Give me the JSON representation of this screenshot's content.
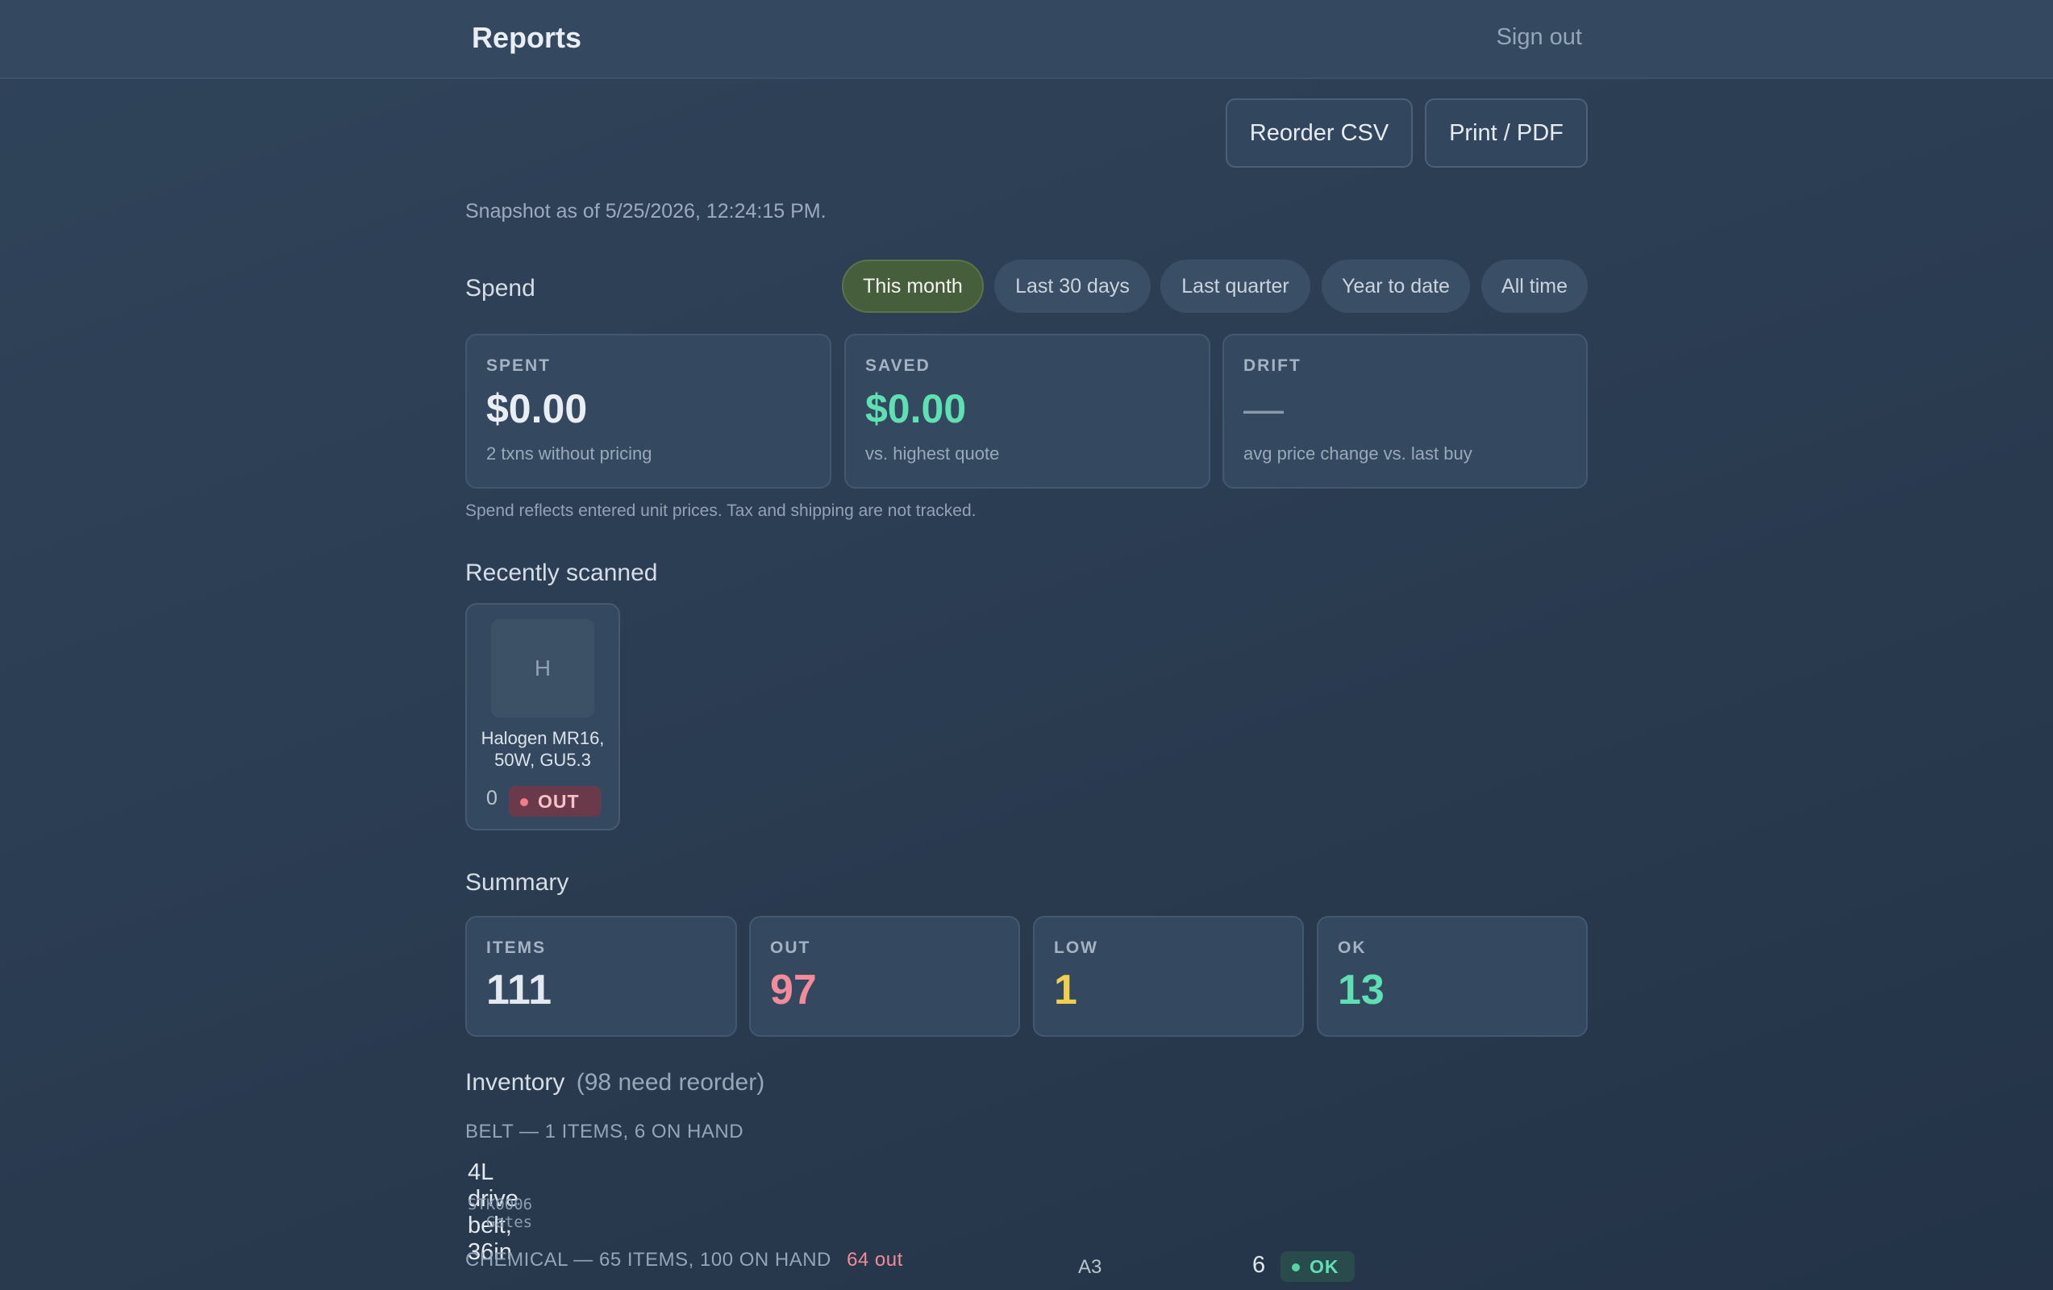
{
  "header": {
    "title": "Reports",
    "signout_label": "Sign out"
  },
  "actions": {
    "reorder_csv": "Reorder CSV",
    "print_pdf": "Print / PDF"
  },
  "snapshot": "Snapshot as of 5/25/2026, 12:24:15 PM.",
  "spend": {
    "title": "Spend",
    "ranges": [
      "This month",
      "Last 30 days",
      "Last quarter",
      "Year to date",
      "All time"
    ],
    "active_range": "This month",
    "cards": [
      {
        "label": "SPENT",
        "value": "$0.00",
        "sub": "2 txns without pricing"
      },
      {
        "label": "SAVED",
        "value": "$0.00",
        "sub": "vs. highest quote"
      },
      {
        "label": "DRIFT",
        "value": "—",
        "sub": "avg price change vs. last buy"
      }
    ],
    "footnote": "Spend reflects entered unit prices. Tax and shipping are not tracked."
  },
  "recent": {
    "title": "Recently scanned",
    "items": [
      {
        "initial": "H",
        "name_line1": "Halogen MR16,",
        "name_line2": "50W, GU5.3",
        "qty": "0",
        "status": "OUT"
      }
    ]
  },
  "summary": {
    "title": "Summary",
    "cards": [
      {
        "label": "ITEMS",
        "value": "111"
      },
      {
        "label": "OUT",
        "value": "97"
      },
      {
        "label": "LOW",
        "value": "1"
      },
      {
        "label": "OK",
        "value": "13"
      }
    ]
  },
  "inventory": {
    "title": "Inventory",
    "reorder_note": "(98 need reorder)",
    "groups": [
      {
        "heading": "BELT — 1 ITEMS, 6 ON HAND",
        "rows": [
          {
            "name": "4L drive belt, 36in",
            "meta": "STK0006 · Gates",
            "location": "A3",
            "qty": "6",
            "status": "OK"
          }
        ]
      },
      {
        "heading": "CHEMICAL — 65 ITEMS, 100 ON HAND",
        "out_note": "64 out"
      }
    ]
  },
  "colors": {
    "accent_green": "#5fe0b3",
    "out_red": "#f48b9a",
    "low_yellow": "#f2d04f",
    "active_chip": "#475e3c"
  }
}
